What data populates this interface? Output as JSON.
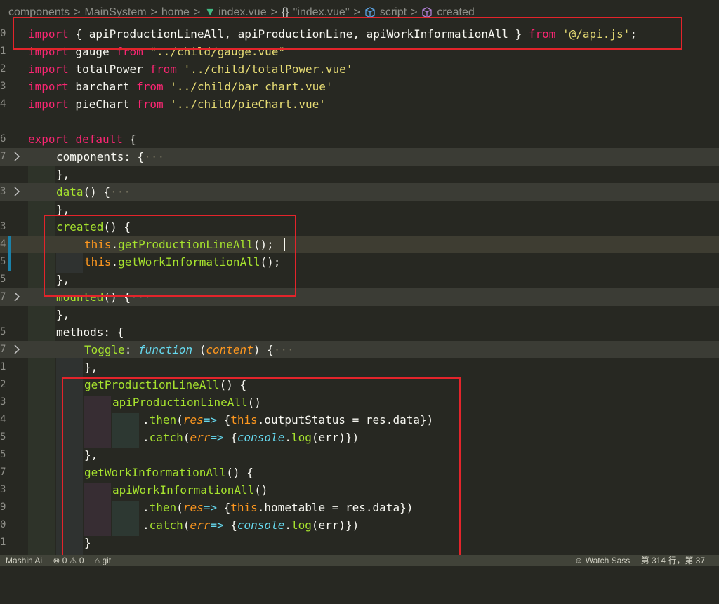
{
  "breadcrumb": {
    "items": [
      "components",
      "MainSystem",
      "home",
      "index.vue",
      "\"index.vue\"",
      "script",
      "created"
    ],
    "separator": ">"
  },
  "line_numbers": [
    "0",
    "1",
    "2",
    "3",
    "4",
    "",
    "6",
    "7",
    "",
    "3",
    "",
    "3",
    "4",
    "5",
    "5",
    "7",
    "",
    "5",
    "7",
    "1",
    "2",
    "3",
    "4",
    "5",
    "5",
    "7",
    "3",
    "9",
    "0",
    "1"
  ],
  "code": {
    "l0": {
      "kw1": "import",
      "t1": " { apiProductionLineAll, apiProductionLine, apiWorkInformationAll } ",
      "kw2": "from",
      "t2": " ",
      "str": "'@/api.js'",
      "t3": ";"
    },
    "l1": {
      "kw1": "import",
      "t1": " gauge ",
      "kw2": "from",
      "t2": " ",
      "str": "\"../child/gauge.vue\""
    },
    "l2": {
      "kw1": "import",
      "t1": " totalPower ",
      "kw2": "from",
      "t2": " ",
      "str": "'../child/totalPower.vue'"
    },
    "l3": {
      "kw1": "import",
      "t1": " barchart ",
      "kw2": "from",
      "t2": " ",
      "str": "'../child/bar_chart.vue'"
    },
    "l4": {
      "kw1": "import",
      "t1": " pieChart ",
      "kw2": "from",
      "t2": " ",
      "str": "'../child/pieChart.vue'"
    },
    "l6": {
      "kw1": "export",
      "t1": " ",
      "kw2": "default",
      "t2": " {"
    },
    "l7": {
      "t1": "components: {",
      "ell": "···"
    },
    "l8": {
      "t1": "},"
    },
    "l9": {
      "fn": "data",
      "t1": "() {",
      "ell": "···"
    },
    "l10": {
      "t1": "},"
    },
    "l11": {
      "fn": "created",
      "t1": "() {"
    },
    "l12": {
      "this": "this",
      "t1": ".",
      "fn": "getProductionLineAll",
      "t2": "();"
    },
    "l13": {
      "this": "this",
      "t1": ".",
      "fn": "getWorkInformationAll",
      "t2": "();"
    },
    "l14": {
      "t1": "},"
    },
    "l15": {
      "fn": "mounted",
      "t1": "() {",
      "ell": "···"
    },
    "l16": {
      "t1": "},"
    },
    "l17": {
      "t1": "methods: {"
    },
    "l18": {
      "fn": "Toggle",
      "t1": ": ",
      "fkw": "function",
      "t2": " (",
      "param": "content",
      "t3": ") {",
      "ell": "···"
    },
    "l19": {
      "t1": "},"
    },
    "l20": {
      "fn": "getProductionLineAll",
      "t1": "() {"
    },
    "l21": {
      "fn": "apiProductionLineAll",
      "t1": "()"
    },
    "l22": {
      "t1": ".",
      "fn": "then",
      "t2": "(",
      "param": "res",
      "arrow": "=>",
      "t3": " {",
      "this": "this",
      "t4": ".outputStatus = res.data})"
    },
    "l23": {
      "t1": ".",
      "fn": "catch",
      "t2": "(",
      "param": "err",
      "arrow": "=>",
      "t3": " {",
      "obj": "console",
      "t4": ".",
      "fn2": "log",
      "t5": "(err)})"
    },
    "l24": {
      "t1": "},"
    },
    "l25": {
      "fn": "getWorkInformationAll",
      "t1": "() {"
    },
    "l26": {
      "fn": "apiWorkInformationAll",
      "t1": "()"
    },
    "l27": {
      "t1": ".",
      "fn": "then",
      "t2": "(",
      "param": "res",
      "arrow": "=>",
      "t3": " {",
      "this": "this",
      "t4": ".hometable = res.data})"
    },
    "l28": {
      "t1": ".",
      "fn": "catch",
      "t2": "(",
      "param": "err",
      "arrow": "=>",
      "t3": " {",
      "obj": "console",
      "t4": ".",
      "fn2": "log",
      "t5": "(err)})"
    },
    "l29": {
      "t1": "}"
    }
  },
  "statusbar": {
    "left": [
      "Mashin Ai",
      "⊗ 0 ⚠ 0",
      "⌂ git"
    ],
    "right": [
      "☺ Watch Sass",
      "第 314 行，第 37"
    ]
  },
  "colors": {
    "background": "#272822",
    "keyword": "#f92672",
    "string": "#e6db74",
    "function": "#a6e22e",
    "this": "#fd971f",
    "highlight_box": "#e3242b"
  }
}
